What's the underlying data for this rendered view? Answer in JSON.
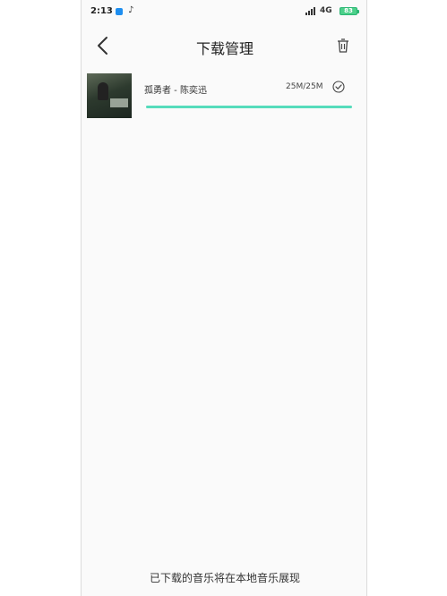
{
  "status_bar": {
    "time": "2:13",
    "app_icon": "blue-square-icon",
    "second_icon": "tiktok-icon",
    "network": "4G",
    "battery": "83"
  },
  "header": {
    "title": "下载管理",
    "back_icon": "chevron-left-icon",
    "delete_icon": "trash-icon"
  },
  "downloads": [
    {
      "song": "孤勇者 - 陈奕迅",
      "size": "25M/25M",
      "progress": 1.0,
      "status_icon": "check-circle-icon"
    }
  ],
  "footer": {
    "note": "已下载的音乐将在本地音乐展现"
  },
  "colors": {
    "progress": "#56dcbc",
    "battery": "#4cd08a"
  }
}
